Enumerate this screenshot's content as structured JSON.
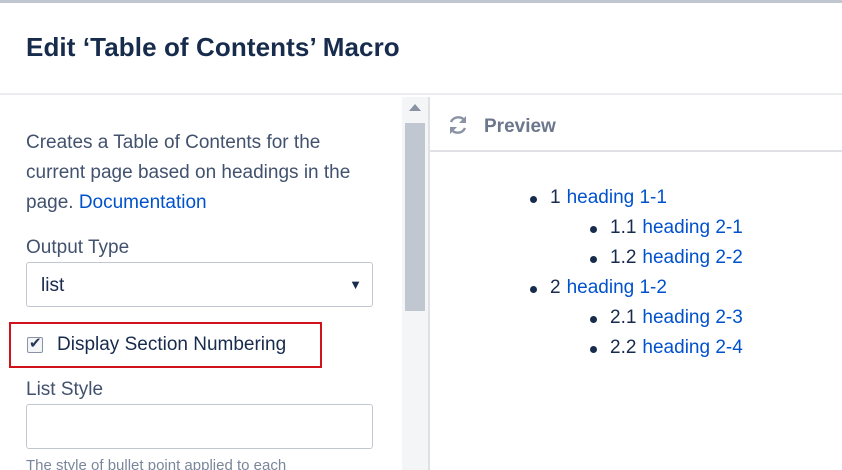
{
  "dialog": {
    "title": "Edit ‘Table of Contents’ Macro"
  },
  "form": {
    "description": "Creates a Table of Contents for the current page based on headings in the page.",
    "doc_link": "Documentation",
    "output_type": {
      "label": "Output Type",
      "value": "list"
    },
    "section_numbering": {
      "label": "Display Section Numbering",
      "checked": true
    },
    "list_style": {
      "label": "List Style",
      "value": ""
    },
    "help_text": "The style of bullet point applied to each"
  },
  "preview": {
    "title": "Preview",
    "items": [
      {
        "number": "1",
        "text": "heading 1-1"
      },
      {
        "number": "1.1",
        "text": "heading 2-1"
      },
      {
        "number": "1.2",
        "text": "heading 2-2"
      },
      {
        "number": "2",
        "text": "heading 1-2"
      },
      {
        "number": "2.1",
        "text": "heading 2-3"
      },
      {
        "number": "2.2",
        "text": "heading 2-4"
      }
    ]
  },
  "icons": {
    "refresh": "refresh-icon",
    "select_arrow": "caret-down-icon",
    "check": "checkmark-icon",
    "scroll_up": "arrow-up-icon"
  },
  "colors": {
    "link": "#0052cc",
    "text": "#172b4d",
    "highlight": "#d0121b"
  }
}
